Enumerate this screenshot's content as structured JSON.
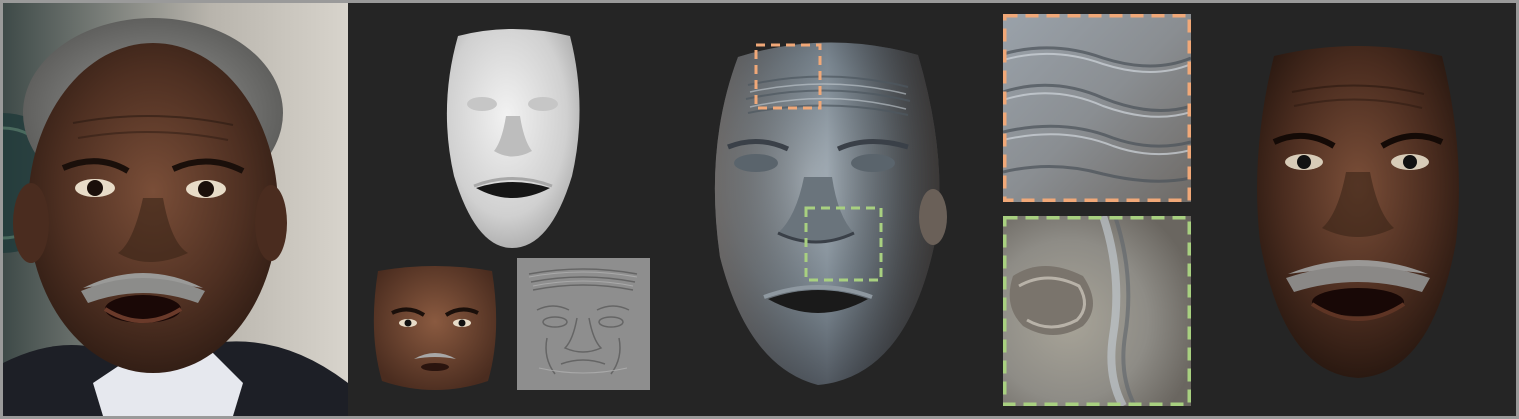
{
  "colors": {
    "background": "#252525",
    "frame": "#9a9a9a",
    "highlight_orange": "#f0a878",
    "highlight_green": "#a8d080",
    "skin_dark": "#3a2418",
    "skin_mid": "#6b4530",
    "geometry_gray": "#d8d8d8",
    "detail_blue_gray": "#7d8a94"
  },
  "panels": [
    "input-photo",
    "coarse-geometry",
    "albedo-texture",
    "displacement-map",
    "detailed-geometry",
    "zoom-forehead",
    "zoom-nose",
    "final-render"
  ]
}
